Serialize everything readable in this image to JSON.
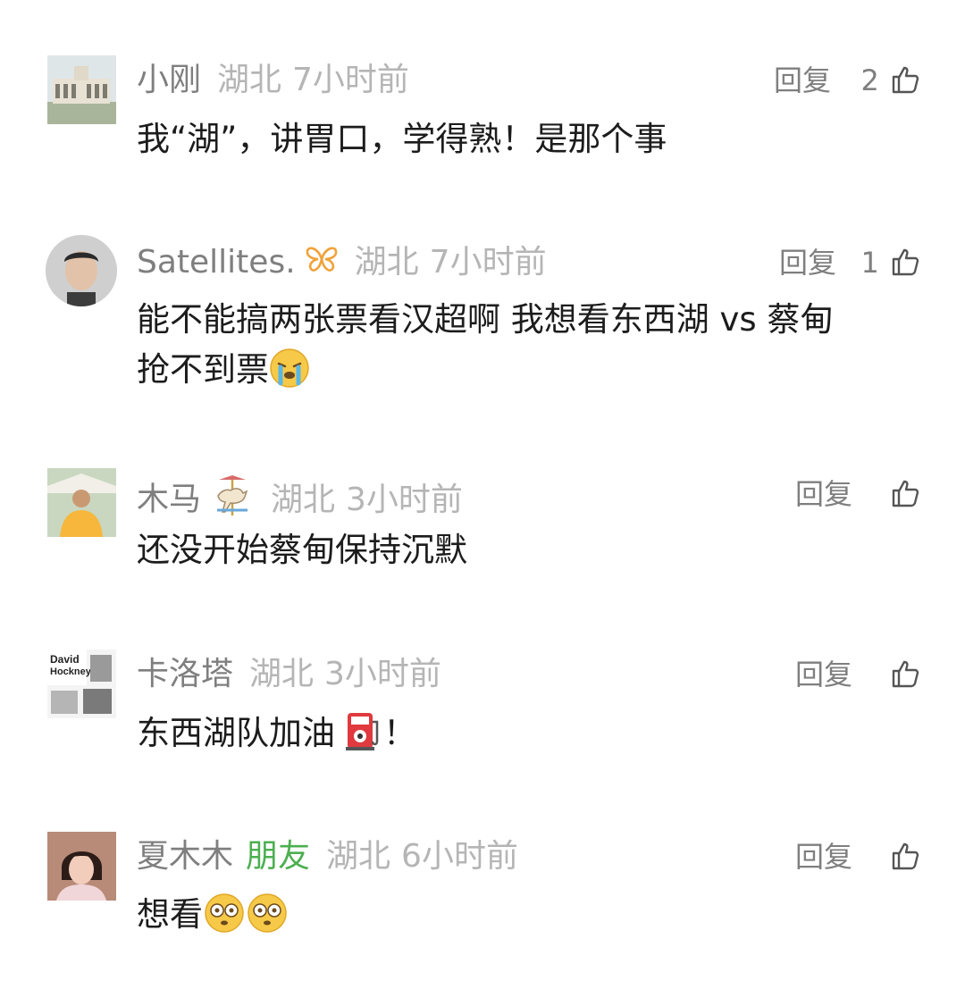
{
  "comments": [
    {
      "name": "小刚",
      "region": "湖北",
      "time": "7小时前",
      "reply": "回复",
      "likes": "2",
      "text": "我“湖”，讲胃口，学得熟！是那个事",
      "avatar": "avatar-building",
      "badge_icon": "",
      "friend": ""
    },
    {
      "name": "Satellites.",
      "region": "湖北",
      "time": "7小时前",
      "reply": "回复",
      "likes": "1",
      "text_line1": "能不能搞两张票看汉超啊 我想看东西湖 vs 蔡甸",
      "text_line2": "抢不到票",
      "text_emoji": "crying-face-emoji",
      "avatar": "avatar-man-portrait",
      "badge_icon": "butterfly-icon",
      "friend": ""
    },
    {
      "name": "木马",
      "region": "湖北",
      "time": "3小时前",
      "reply": "回复",
      "likes": "",
      "text": "还没开始蔡甸保持沉默",
      "avatar": "avatar-person-yellow-shirt",
      "badge_icon": "carousel-horse-icon",
      "friend": ""
    },
    {
      "name": "卡洛塔",
      "region": "湖北",
      "time": "3小时前",
      "reply": "回复",
      "likes": "",
      "text": "东西湖队加油",
      "text_suffix": "！",
      "text_emoji": "fuel-pump-emoji",
      "avatar": "avatar-david-hockney-poster",
      "avatar_text_1": "David",
      "avatar_text_2": "Hockney",
      "badge_icon": "",
      "friend": ""
    },
    {
      "name": "夏木木",
      "region": "湖北",
      "time": "6小时前",
      "reply": "回复",
      "likes": "",
      "text": "想看",
      "text_emoji": "flushed-face-emoji",
      "friend": "朋友",
      "avatar": "avatar-girl-portrait",
      "badge_icon": ""
    }
  ],
  "colors": {
    "name": "#7f7f7f",
    "meta": "#b5b5b5",
    "friend": "#4caf50",
    "text": "#1c1c1c"
  }
}
